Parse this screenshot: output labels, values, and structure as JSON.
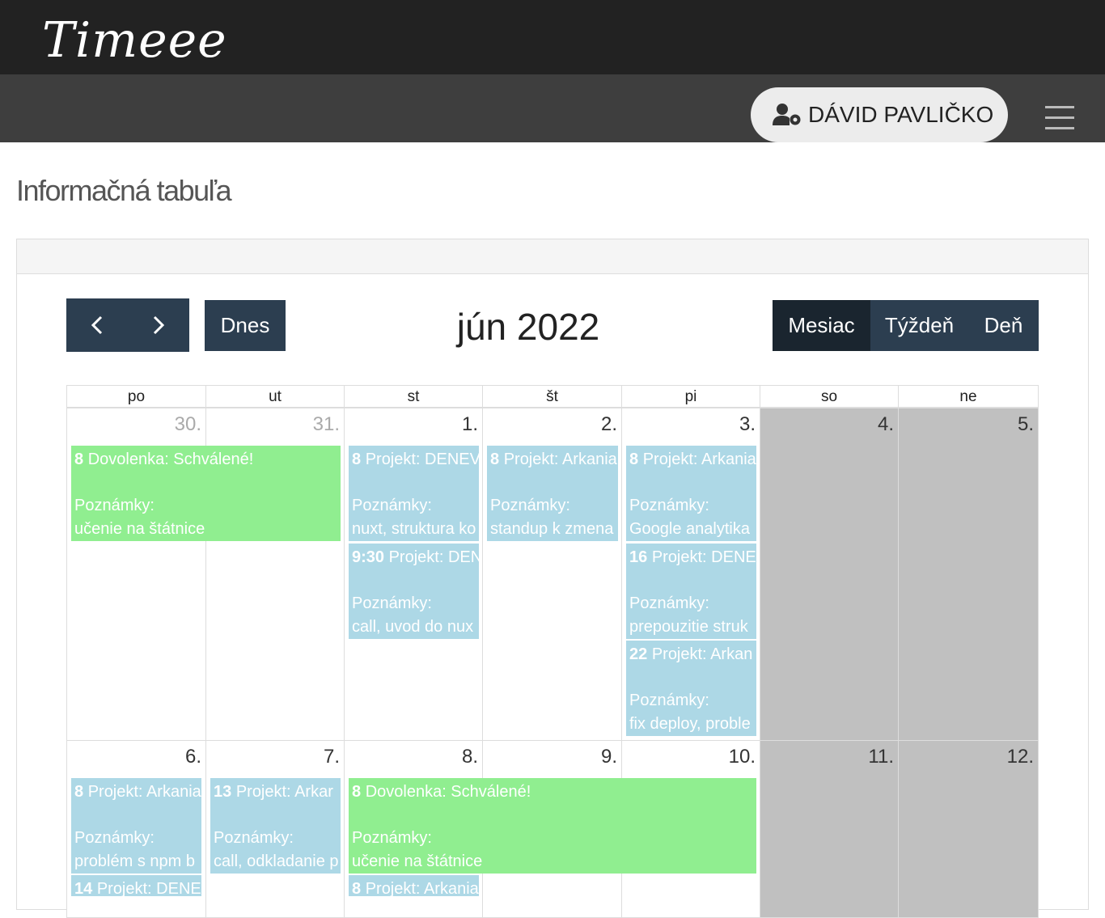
{
  "app": {
    "logo": "Timeee"
  },
  "navbar": {
    "user_name": "DÁVID PAVLIČKO"
  },
  "page": {
    "title": "Informačná tabuľa"
  },
  "calendar": {
    "title": "jún 2022",
    "today_label": "Dnes",
    "views": {
      "month": "Mesiac",
      "week": "Týždeň",
      "day": "Deň",
      "active": "month"
    },
    "weekdays": [
      "po",
      "ut",
      "st",
      "št",
      "pi",
      "so",
      "ne"
    ],
    "days": [
      "30.",
      "31.",
      "1.",
      "2.",
      "3.",
      "4.",
      "5.",
      "6.",
      "7.",
      "8.",
      "9.",
      "10.",
      "11.",
      "12."
    ],
    "events": [
      {
        "time": "8",
        "title": "Dovolenka: Schválené!",
        "notes_label": "Poznámky:",
        "notes": "učenie na štátnice",
        "type": "vacation"
      },
      {
        "time": "8",
        "title": "Projekt: DENEV",
        "notes_label": "Poznámky:",
        "notes": "nuxt, struktura ko",
        "type": "project"
      },
      {
        "time": "9:30",
        "title": "Projekt: DEN",
        "notes_label": "Poznámky:",
        "notes": "call, uvod do nux",
        "type": "project"
      },
      {
        "time": "8",
        "title": "Projekt: Arkania",
        "notes_label": "Poznámky:",
        "notes": "standup k zmena",
        "type": "project"
      },
      {
        "time": "8",
        "title": "Projekt: Arkania",
        "notes_label": "Poznámky:",
        "notes": "Google analytika",
        "type": "project"
      },
      {
        "time": "16",
        "title": "Projekt: DENE",
        "notes_label": "Poznámky:",
        "notes": "prepouzitie struk",
        "type": "project"
      },
      {
        "time": "22",
        "title": "Projekt: Arkan",
        "notes_label": "Poznámky:",
        "notes": "fix deploy, proble",
        "type": "project"
      },
      {
        "time": "8",
        "title": "Projekt: Arkania",
        "notes_label": "Poznámky:",
        "notes": "problém s npm b",
        "type": "project"
      },
      {
        "time": "14",
        "title": "Projekt: DENE",
        "type": "project"
      },
      {
        "time": "13",
        "title": "Projekt: Arkar",
        "notes_label": "Poznámky:",
        "notes": "call, odkladanie p",
        "type": "project"
      },
      {
        "time": "8",
        "title": "Dovolenka: Schválené!",
        "notes_label": "Poznámky:",
        "notes": "učenie na štátnice",
        "type": "vacation"
      },
      {
        "time": "8",
        "title": "Projekt: Arkania",
        "type": "project"
      }
    ],
    "colors": {
      "project": "#add8e6",
      "vacation": "#90ee90",
      "weekend": "#c0c0c0",
      "toolbar": "#2c3e50",
      "toolbar_active": "#1a252f"
    }
  },
  "icons": {
    "user": "user-gear-icon",
    "menu": "hamburger-menu-icon",
    "prev": "chevron-left-icon",
    "next": "chevron-right-icon"
  }
}
